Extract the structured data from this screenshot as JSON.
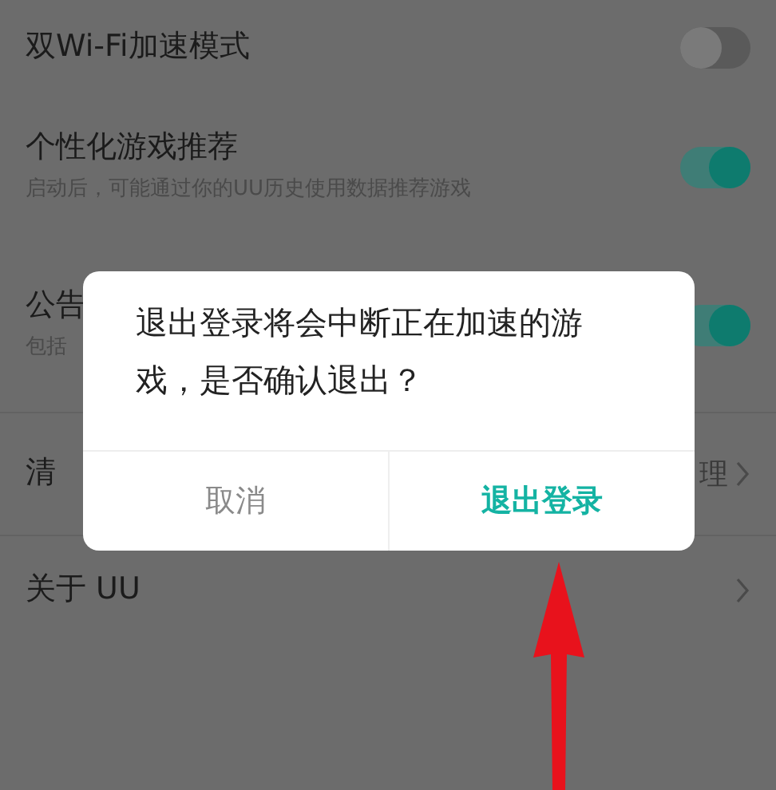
{
  "settings": [
    {
      "kind": "toggle",
      "title": "双Wi-Fi加速模式",
      "on": false
    },
    {
      "kind": "toggle",
      "title": "个性化游戏推荐",
      "subtitle": "启动后，可能通过你的UU历史使用数据推荐游戏",
      "on": true
    },
    {
      "kind": "toggle",
      "title": "公告",
      "subtitle": "包括",
      "on": true
    },
    {
      "kind": "link",
      "title": "清",
      "value": "理"
    },
    {
      "kind": "link",
      "title": "关于 UU"
    }
  ],
  "dialog": {
    "message": "退出登录将会中断正在加速的游戏，是否确认退出？",
    "buttons": [
      {
        "label": "取消",
        "kind": "cancel"
      },
      {
        "label": "退出登录",
        "kind": "confirm"
      }
    ]
  }
}
